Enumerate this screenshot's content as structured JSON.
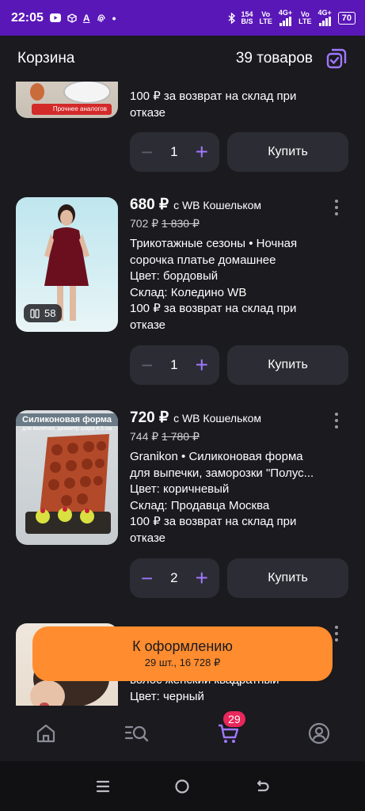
{
  "status_bar": {
    "time": "22:05",
    "net_speed_top": "154",
    "net_speed_bottom": "B/S",
    "sim1_top": "Vo",
    "sim1_bottom": "LTE",
    "sim1_signal": "4G+",
    "sim2_top": "Vo",
    "sim2_bottom": "LTE",
    "sim2_signal": "4G+",
    "battery": "70"
  },
  "header": {
    "title": "Корзина",
    "count": "39 товаров"
  },
  "items": [
    {
      "return_line1": "100 ₽ за возврат на склад при",
      "return_line2": "отказе",
      "quantity": "1",
      "buy_label": "Купить",
      "thumb_text": "Прочнее аналогов"
    },
    {
      "price": "680 ₽",
      "wallet": "с WB Кошельком",
      "price_prefix": "702 ₽",
      "price_old": "1 830 ₽",
      "desc_line1": "Трикотажные сезоны • Ночная",
      "desc_line2": "сорочка платье домашнее",
      "color": "Цвет: бордовый",
      "warehouse": "Склад: Коледино WB",
      "return_line1": "100 ₽ за возврат на склад при",
      "return_line2": "отказе",
      "quantity": "1",
      "buy_label": "Купить",
      "photos": "58"
    },
    {
      "price": "720 ₽",
      "wallet": "с WB Кошельком",
      "price_prefix": "744 ₽",
      "price_old": "1 780 ₽",
      "desc_line1": "Granikon • Силиконовая форма",
      "desc_line2": "для выпечки, заморозки \"Полус...",
      "color": "Цвет: коричневый",
      "warehouse": "Склад: Продавца Москва",
      "return_line1": "100 ₽ за возврат на склад при",
      "return_line2": "отказе",
      "quantity": "2",
      "buy_label": "Купить",
      "thumb_title": "Силиконовая форма",
      "thumb_sub": "для выпечки, диаметр шара 4.5 см"
    },
    {
      "desc_line2": "волос женский квадратный",
      "color": "Цвет: черный"
    }
  ],
  "checkout": {
    "label": "К оформлению",
    "summary": "29 шт., 16 728 ₽"
  },
  "nav": {
    "cart_badge": "29"
  },
  "colors": {
    "status_bar": "#5a17b8",
    "background": "#1a1a1f",
    "accent": "#a078ff",
    "checkout": "#ff8c2e",
    "badge": "#e8275b"
  }
}
